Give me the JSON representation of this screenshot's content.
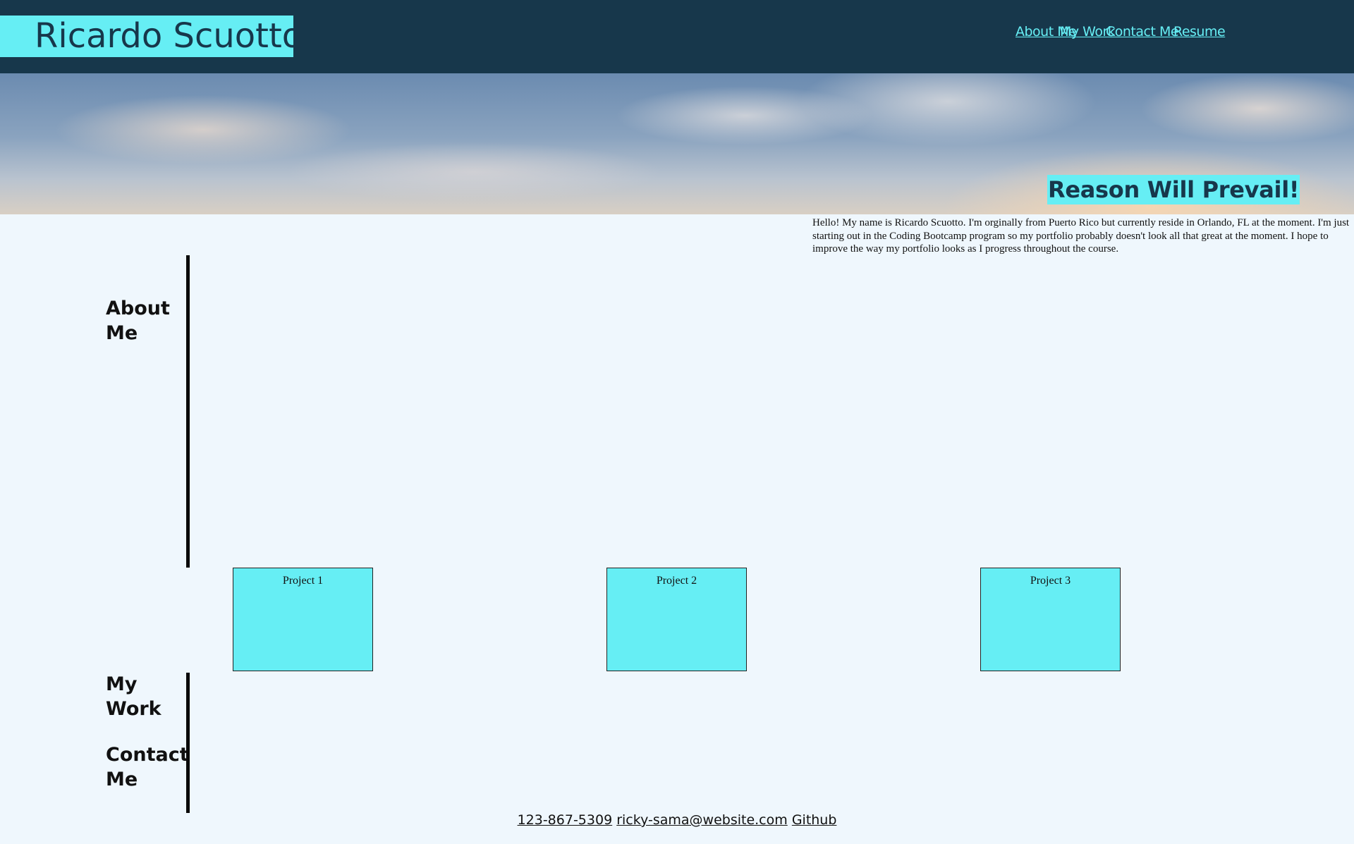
{
  "header": {
    "site_name": "Ricardo Scuotto",
    "nav": [
      {
        "label": "About Me"
      },
      {
        "label": "My Work"
      },
      {
        "label": "Contact Me"
      },
      {
        "label": "Resume"
      }
    ]
  },
  "hero": {
    "tagline": "Reason Will Prevail!"
  },
  "intro": {
    "text": "Hello! My name is Ricardo Scuotto. I'm orginally from Puerto Rico but currently reside in Orlando, FL at the moment. I'm just starting out in the Coding Bootcamp program so my portfolio probably doesn't look all that great at the moment. I hope to improve the way my portfolio looks as I progress throughout the course."
  },
  "sections": {
    "about": "About Me",
    "work": "My Work",
    "contact": "Contact Me"
  },
  "projects": [
    {
      "label": "Project 1"
    },
    {
      "label": "Project 2"
    },
    {
      "label": "Project 3"
    }
  ],
  "footer": {
    "phone": "123-867-5309",
    "email": "ricky-sama@website.com",
    "github": "Github"
  },
  "colors": {
    "header_bg": "#17374b",
    "accent_cyan": "#66eef4",
    "page_bg": "#eff7fd"
  }
}
